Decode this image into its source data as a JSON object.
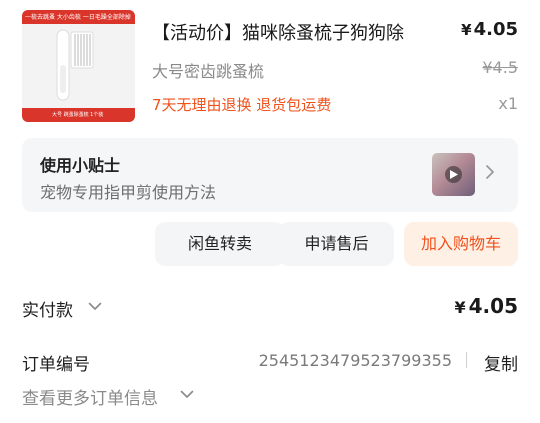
{
  "product": {
    "image_top_text": "一梳去跳蚤  大小齿梳  一日毛躁全部除掉",
    "image_bottom_text": "大号 跳蚤除蚤梳 1个装",
    "title": "【活动价】猫咪除蚤梳子狗狗除",
    "price_symbol": "¥",
    "price": "4.05",
    "subtitle": "大号密齿跳蚤梳",
    "original_price": "¥4.5",
    "promise": "7天无理由退换  退货包运费",
    "quantity": "x1"
  },
  "tips": {
    "title": "使用小贴士",
    "desc": "宠物专用指甲剪使用方法"
  },
  "actions": {
    "resell": "闲鱼转卖",
    "after_sale": "申请售后",
    "add_to_cart": "加入购物车"
  },
  "summary": {
    "paid_label": "实付款",
    "paid_symbol": "¥",
    "paid_value": "4.05",
    "order_no_label": "订单编号",
    "order_no": "2545123479523799355",
    "copy_label": "复制",
    "more_info": "查看更多订单信息"
  },
  "colors": {
    "accent": "#f0521d",
    "accent_bg": "#fff0e6",
    "card_bg": "#f5f6f8"
  },
  "icons": [
    "chevron-right-icon",
    "chevron-down-icon",
    "play-icon"
  ]
}
